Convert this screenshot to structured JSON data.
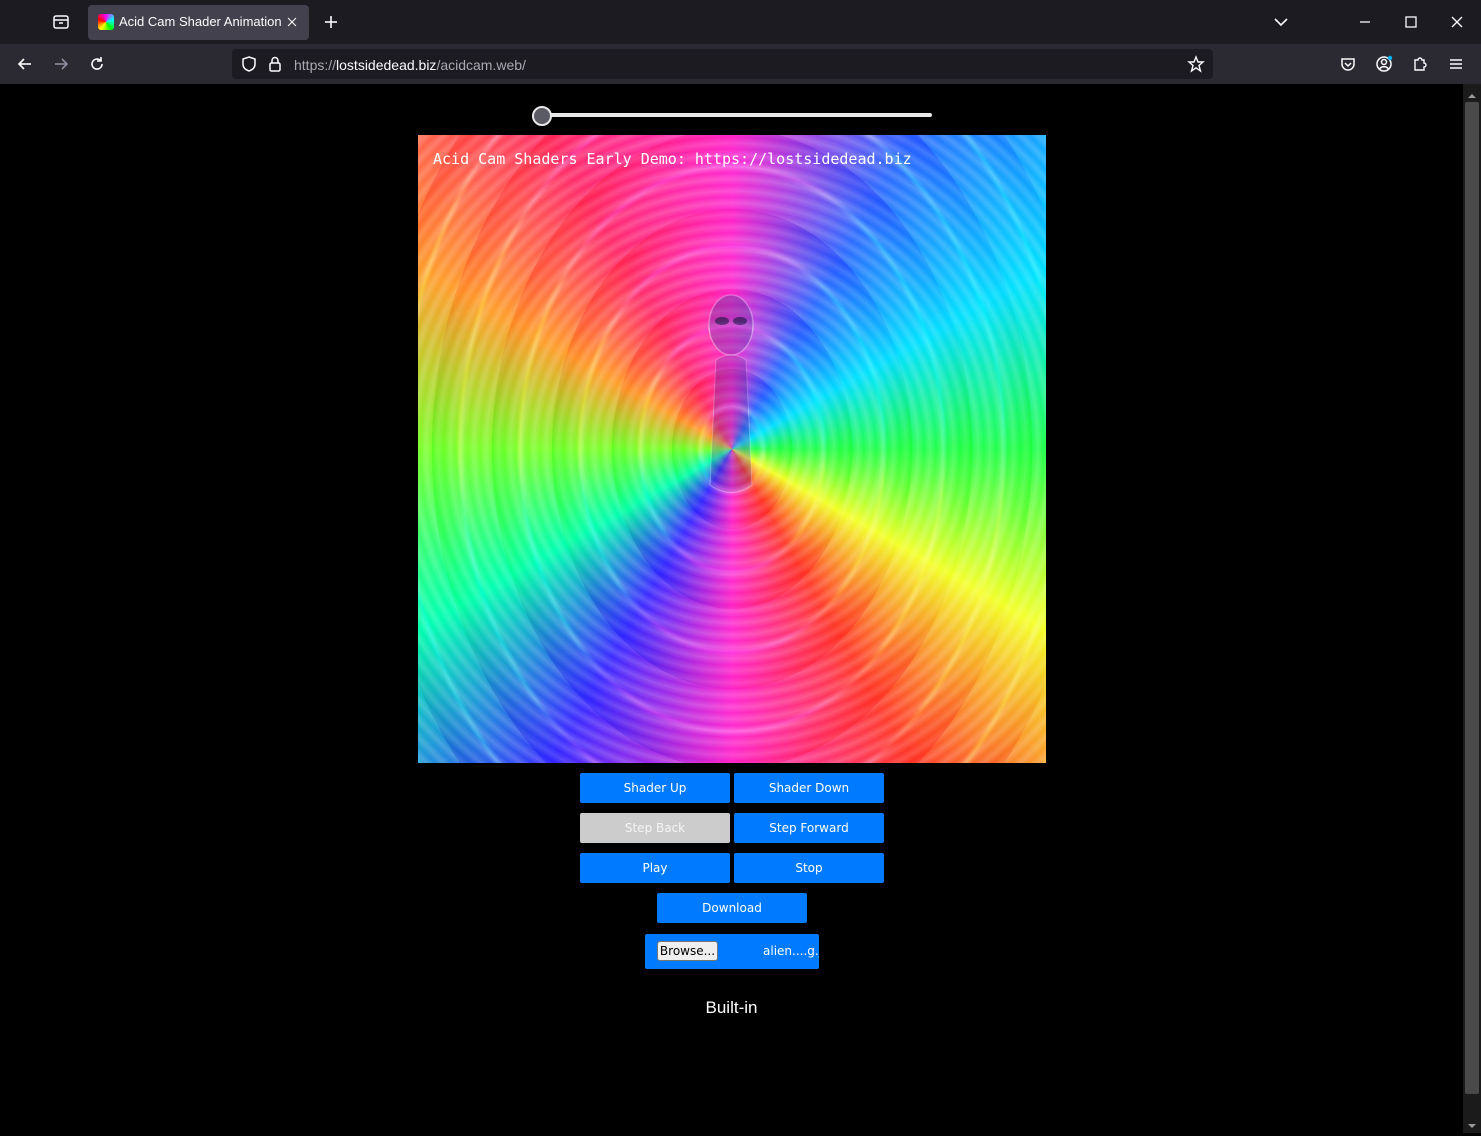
{
  "browser": {
    "tab_title": "Acid Cam Shader Animation",
    "url_scheme": "https://",
    "url_host": "lostsidedead.biz",
    "url_path": "/acidcam.web/"
  },
  "page": {
    "slider": {
      "value": 0.0
    },
    "canvas_overlay_text": "Acid Cam Shaders Early Demo: https://lostsidedead.biz",
    "buttons": {
      "shader_up": "Shader Up",
      "shader_down": "Shader Down",
      "step_back": "Step Back",
      "step_forward": "Step Forward",
      "play": "Play",
      "stop": "Stop",
      "download": "Download"
    },
    "file_input": {
      "browse_label": "Browse...",
      "file_name": "alien....g.jp"
    },
    "mode_label": "Built-in"
  },
  "colors": {
    "button_blue": "#007bff",
    "button_disabled": "#cccccc"
  }
}
